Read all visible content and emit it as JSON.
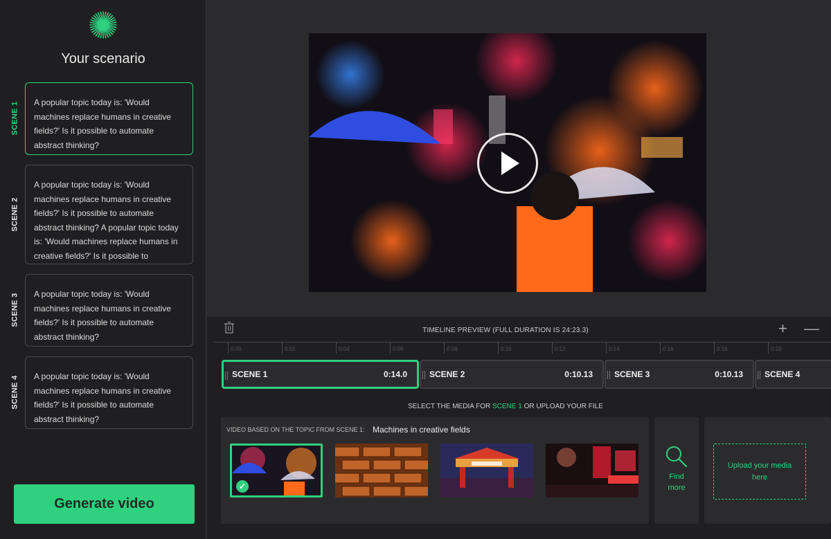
{
  "sidebar": {
    "title": "Your scenario",
    "scenes": [
      {
        "label": "SCENE 1",
        "text": "A popular topic today is: 'Would machines replace humans in creative fields?' Is it possible to automate abstract thinking?"
      },
      {
        "label": "SCENE 2",
        "text": "A popular topic today is: 'Would machines replace humans in creative fields?' Is it possible to automate abstract thinking? A popular topic today is: 'Would machines replace humans in creative fields?' Is it possible to automate abstract thinking?"
      },
      {
        "label": "SCENE 3",
        "text": "A popular topic today is: 'Would machines replace humans in creative fields?' Is it possible to automate abstract thinking?"
      },
      {
        "label": "SCENE 4",
        "text": "A popular topic today is: 'Would machines replace humans in creative fields?' Is it possible to automate abstract thinking?"
      }
    ],
    "generate_label": "Generate video"
  },
  "timeline": {
    "title": "TIMELINE PREVIEW (FULL DURATION IS 24:23.3)",
    "plus": "+",
    "minus": "—",
    "ticks": [
      "0:00",
      "0:02",
      "0:04",
      "0:06",
      "0:08",
      "0:10",
      "0:12",
      "0:14",
      "0:16",
      "0:18",
      "0:20"
    ],
    "clips": [
      {
        "name": "SCENE 1",
        "duration": "0:14.0"
      },
      {
        "name": "SCENE 2",
        "duration": "0:10.13"
      },
      {
        "name": "SCENE 3",
        "duration": "0:10.13"
      },
      {
        "name": "SCENE 4",
        "duration": ""
      }
    ]
  },
  "media": {
    "select_prefix": "SELECT THE MEDIA FOR",
    "select_scene": "SCENE 1",
    "select_suffix": "OR UPLOAD YOUR FILE",
    "panel_label": "VIDEO BASED ON THE TOPIC FROM SCENE 1:",
    "topic": "Machines in creative fields",
    "find_label_1": "Find",
    "find_label_2": "more",
    "upload_label": "Upload your media here"
  },
  "colors": {
    "accent": "#2fd17f",
    "sidebar_bg": "#1f1f21",
    "main_bg": "#2b2b2d"
  }
}
